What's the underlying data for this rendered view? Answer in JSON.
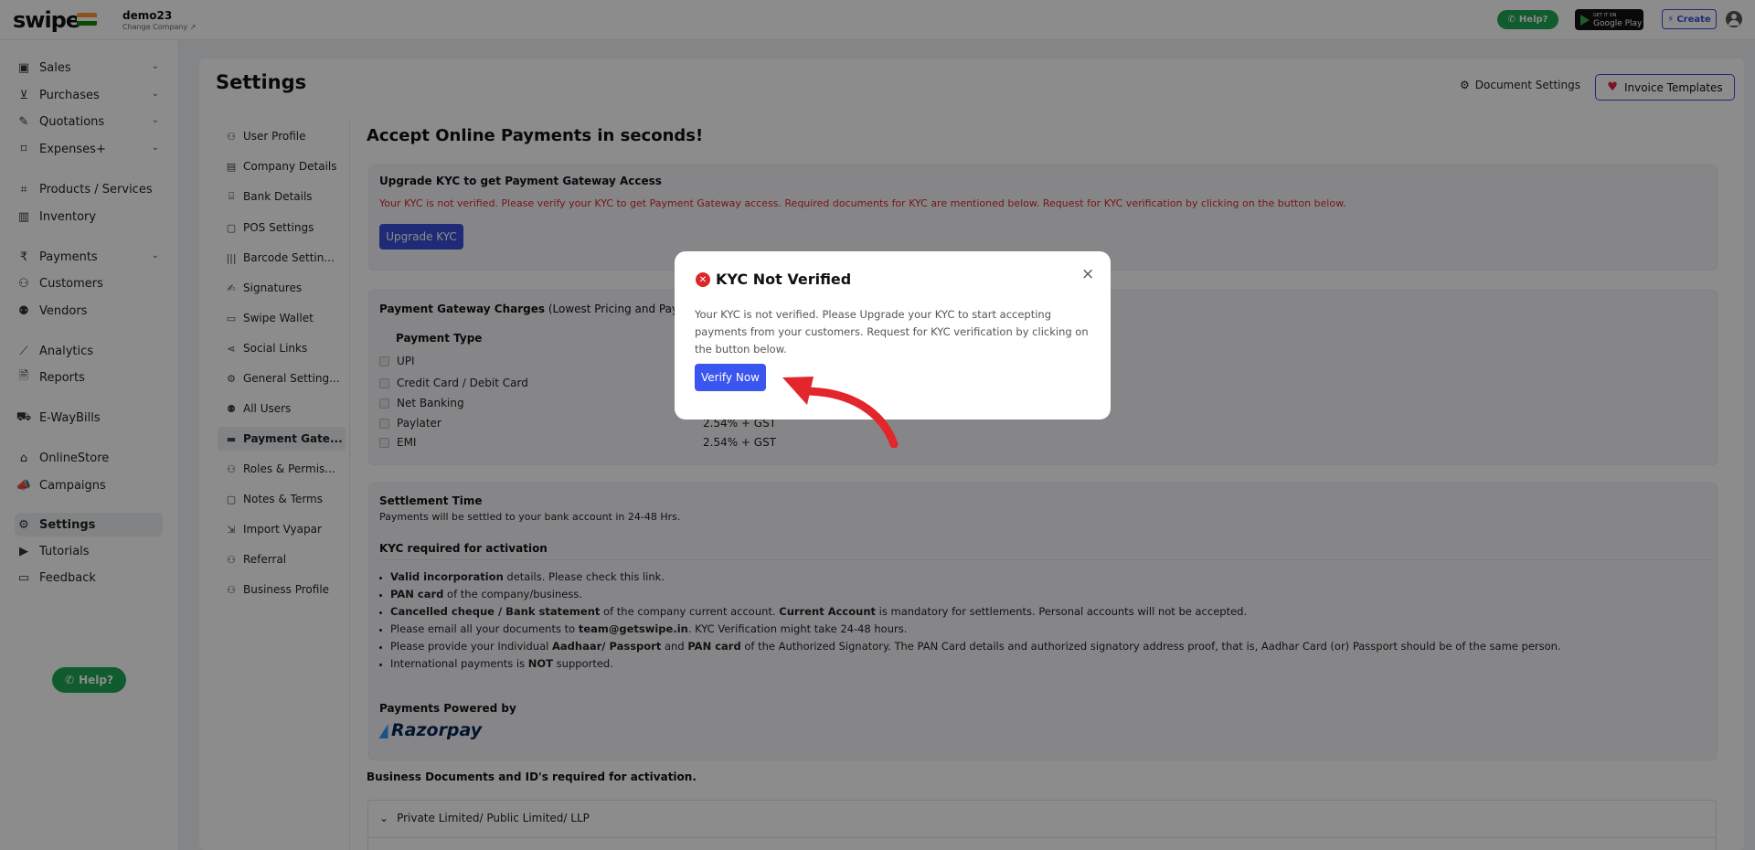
{
  "header": {
    "logo": "swipe",
    "company_name": "demo23",
    "change_company": "Change Company ↗",
    "help_label": "Help?",
    "gplay_small": "GET IT ON",
    "gplay_label": "Google Play",
    "create_label": "Create"
  },
  "leftnav": {
    "items": [
      {
        "label": "Sales",
        "icon": "banknote-icon"
      },
      {
        "label": "Purchases",
        "icon": "cart-icon"
      },
      {
        "label": "Quotations",
        "icon": "pen-icon"
      },
      {
        "label": "Expenses+",
        "icon": "tag-icon"
      },
      {
        "label": "Products / Services",
        "icon": "scan-icon"
      },
      {
        "label": "Inventory",
        "icon": "chart-icon"
      },
      {
        "label": "Payments",
        "icon": "rupee-icon"
      },
      {
        "label": "Customers",
        "icon": "user-icon"
      },
      {
        "label": "Vendors",
        "icon": "users-icon"
      },
      {
        "label": "Analytics",
        "icon": "trend-icon"
      },
      {
        "label": "Reports",
        "icon": "file-icon"
      },
      {
        "label": "E-WayBills",
        "icon": "truck-icon"
      },
      {
        "label": "OnlineStore",
        "icon": "store-icon"
      },
      {
        "label": "Campaigns",
        "icon": "megaphone-icon"
      },
      {
        "label": "Settings",
        "icon": "gear-icon"
      },
      {
        "label": "Tutorials",
        "icon": "youtube-icon"
      },
      {
        "label": "Feedback",
        "icon": "message-icon"
      }
    ],
    "help_label": "Help?"
  },
  "page": {
    "title": "Settings",
    "document_settings": "Document Settings",
    "invoice_templates": "Invoice Templates"
  },
  "settings_nav": [
    "User Profile",
    "Company Details",
    "Bank Details",
    "POS Settings",
    "Barcode Settin...",
    "Signatures",
    "Swipe Wallet",
    "Social Links",
    "General Setting...",
    "All Users",
    "Payment Gate...",
    "Roles & Permis...",
    "Notes & Terms",
    "Import Vyapar",
    "Referral",
    "Business Profile"
  ],
  "content": {
    "heading": "Accept Online Payments in seconds!",
    "upgrade_title": "Upgrade KYC to get Payment Gateway Access",
    "kyc_warning": "Your KYC is not verified. Please verify your KYC to get Payment Gateway access. Required documents for KYC are mentioned below. Request for KYC verification by clicking on the button below.",
    "upgrade_button": "Upgrade KYC",
    "charges_title_bold": "Payment Gateway Charges",
    "charges_title_rest": " (Lowest Pricing and Payme",
    "payment_type_header": "Payment Type",
    "payment_types": [
      "UPI",
      "Credit Card / Debit Card",
      "Net Banking",
      "Paylater",
      "EMI"
    ],
    "charges": [
      "",
      "",
      "",
      "2.54% + GST",
      "2.54% + GST"
    ],
    "settlement_title": "Settlement Time",
    "settlement_desc": "Payments will be settled to your bank account in 24-48 Hrs.",
    "kyc_required_title": "KYC required for activation",
    "requirements": [
      {
        "bold": "Valid incorporation",
        "rest": " details. Please check this link."
      },
      {
        "bold": "PAN card",
        "rest": " of the company/business."
      },
      {
        "bold": "Cancelled cheque / Bank statement",
        "rest": " of the company current account. ",
        "bold2": "Current Account",
        "rest2": " is mandatory for settlements. Personal accounts will not be accepted."
      },
      {
        "pre": "Please email all your documents to ",
        "bold": "team@getswipe.in",
        "rest": ". KYC Verification might take 24-48 hours."
      },
      {
        "pre": "Please provide your Individual ",
        "bold": "Aadhaar/ Passport",
        "rest": " and ",
        "bold2": "PAN card",
        "rest2": " of the Authorized Signatory. The PAN Card details and authorized signatory address proof, that is, Aadhar Card (or) Passport should be of the same person."
      },
      {
        "pre": "International payments is ",
        "bold": "NOT",
        "rest": " supported."
      }
    ],
    "powered_by": "Payments Powered by",
    "razorpay": "Razorpay",
    "business_docs": "Business Documents and ID's required for activation.",
    "accordion_label": "Private Limited/ Public Limited/ LLP"
  },
  "modal": {
    "title": "KYC Not Verified",
    "body": "Your KYC is not verified. Please Upgrade your KYC to start accepting payments from your customers. Request for KYC verification by clicking on the button below.",
    "verify_button": "Verify Now",
    "close": "×"
  },
  "colors": {
    "accent": "#3a4fd8",
    "whatsapp_green": "#1fa855",
    "error_red": "#d8282a",
    "arrow_red": "#e3262b"
  }
}
